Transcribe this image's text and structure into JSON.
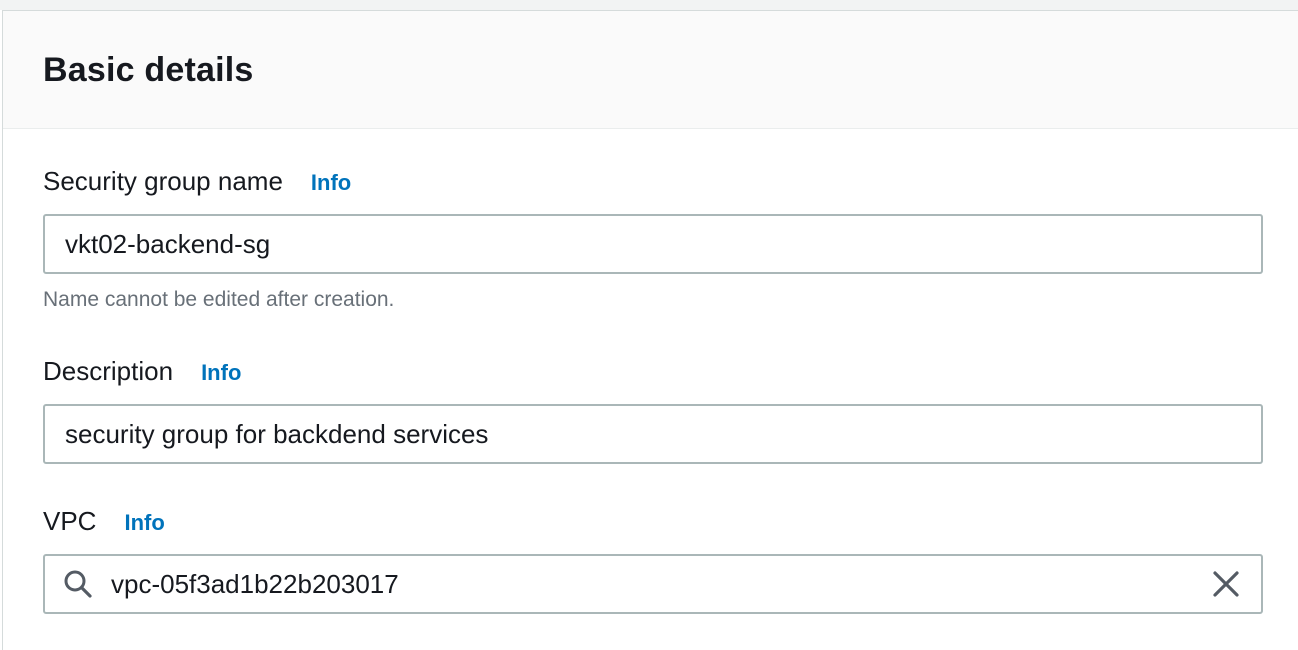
{
  "panel": {
    "title": "Basic details"
  },
  "fields": {
    "name": {
      "label": "Security group name",
      "info": "Info",
      "value": "vkt02-backend-sg",
      "hint": "Name cannot be edited after creation."
    },
    "description": {
      "label": "Description",
      "info": "Info",
      "value": "security group for backdend services"
    },
    "vpc": {
      "label": "VPC",
      "info": "Info",
      "value": "vpc-05f3ad1b22b203017",
      "icons": [
        "search-icon",
        "close-icon"
      ]
    }
  },
  "colors": {
    "link": "#0073bb",
    "text": "#16191f",
    "hint": "#687078",
    "border": "#aab7b8"
  }
}
